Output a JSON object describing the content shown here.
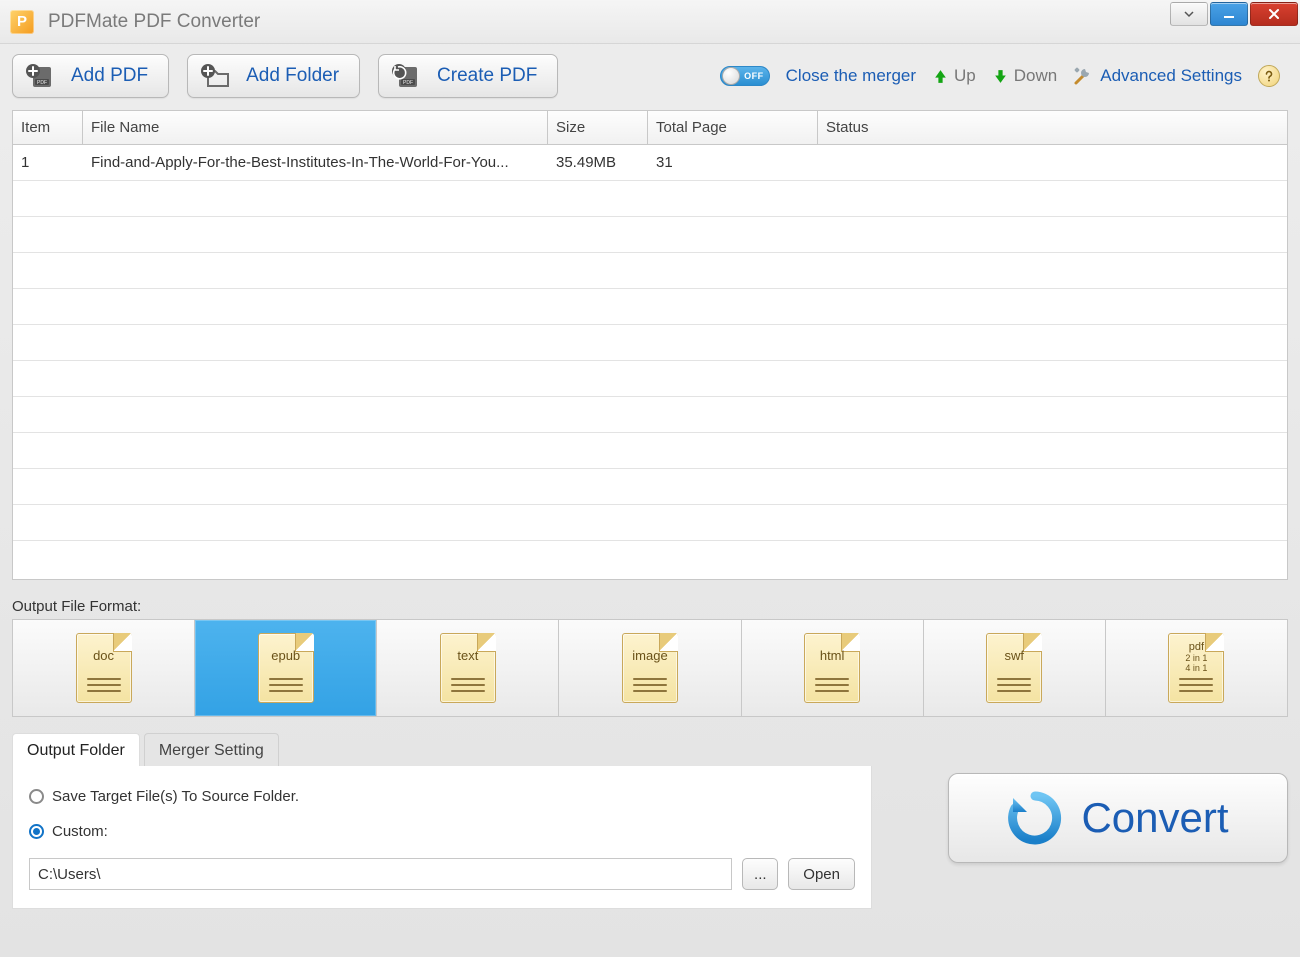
{
  "title": "PDFMate PDF Converter",
  "app_logo_letter": "P",
  "toolbar": {
    "add_pdf": "Add PDF",
    "add_folder": "Add Folder",
    "create_pdf": "Create PDF",
    "merger_toggle": "OFF",
    "merger_label": "Close the merger",
    "up": "Up",
    "down": "Down",
    "advanced": "Advanced Settings"
  },
  "grid": {
    "headers": {
      "item": "Item",
      "file": "File Name",
      "size": "Size",
      "page": "Total Page",
      "status": "Status"
    },
    "rows": [
      {
        "item": "1",
        "file": "Find-and-Apply-For-the-Best-Institutes-In-The-World-For-You...",
        "size": "35.49MB",
        "page": "31",
        "status": ""
      }
    ]
  },
  "output_format_label": "Output File Format:",
  "formats": [
    "doc",
    "epub",
    "text",
    "image",
    "html",
    "swf",
    "pdf"
  ],
  "selected_format_index": 1,
  "pdf_sub1": "2 in 1",
  "pdf_sub2": "4 in 1",
  "tabs": {
    "output_folder": "Output Folder",
    "merger_setting": "Merger Setting",
    "active": 0
  },
  "output": {
    "radio_source": "Save Target File(s) To Source Folder.",
    "radio_custom": "Custom:",
    "selected_radio": 1,
    "path_value": "C:\\Users\\",
    "browse": "...",
    "open": "Open"
  },
  "convert_label": "Convert"
}
